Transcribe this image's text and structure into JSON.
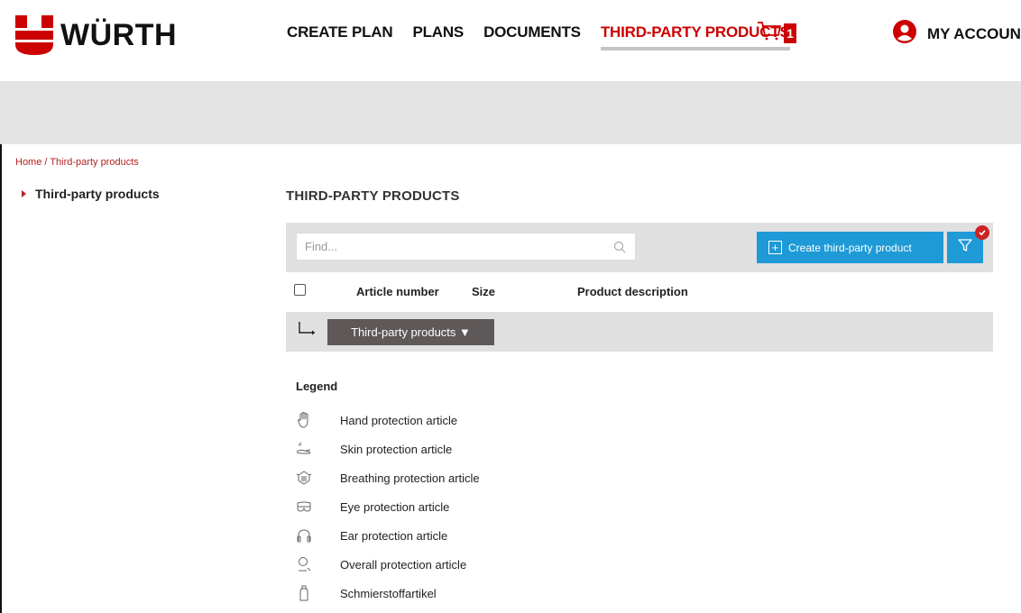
{
  "brand": {
    "name": "WÜRTH",
    "color": "#cc0000"
  },
  "nav": {
    "items": [
      {
        "label": "CREATE PLAN"
      },
      {
        "label": "PLANS"
      },
      {
        "label": "DOCUMENTS"
      },
      {
        "label": "THIRD-PARTY PRODUCTS",
        "active": true
      }
    ],
    "cart_count": "1",
    "account_label": "MY ACCOUNT"
  },
  "breadcrumb": {
    "home": "Home",
    "separator": " / ",
    "current": "Third-party products"
  },
  "sidebar": {
    "items": [
      {
        "label": "Third-party products"
      }
    ]
  },
  "main": {
    "title": "THIRD-PARTY PRODUCTS",
    "search": {
      "placeholder": "Find...",
      "value": ""
    },
    "create_label": "Create third-party product",
    "table": {
      "columns": [
        "Article number",
        "Size",
        "Product description"
      ]
    },
    "group_label": "Third-party products ▼"
  },
  "legend": {
    "title": "Legend",
    "items": [
      {
        "icon": "hand-icon",
        "label": "Hand protection article"
      },
      {
        "icon": "skin-icon",
        "label": "Skin protection article"
      },
      {
        "icon": "breathing-icon",
        "label": "Breathing protection article"
      },
      {
        "icon": "eye-icon",
        "label": "Eye protection article"
      },
      {
        "icon": "ear-icon",
        "label": "Ear protection article"
      },
      {
        "icon": "overall-icon",
        "label": "Overall protection article"
      },
      {
        "icon": "lubricant-icon",
        "label": "Schmierstoffartikel"
      }
    ]
  },
  "colors": {
    "accent_blue": "#1e9ad6",
    "brand_red": "#cc0000",
    "group_button": "#5e5858",
    "toolbar_gray": "#e0e0e0"
  }
}
